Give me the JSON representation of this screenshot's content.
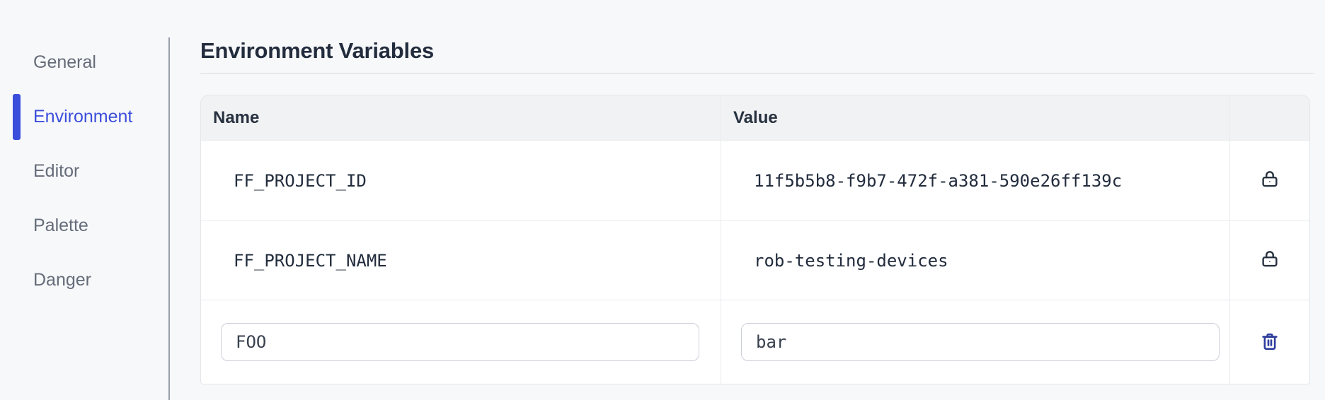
{
  "sidebar": {
    "items": [
      {
        "label": "General",
        "active": false
      },
      {
        "label": "Environment",
        "active": true
      },
      {
        "label": "Editor",
        "active": false
      },
      {
        "label": "Palette",
        "active": false
      },
      {
        "label": "Danger",
        "active": false
      }
    ]
  },
  "main": {
    "title": "Environment Variables",
    "table": {
      "headers": {
        "name": "Name",
        "value": "Value",
        "actions": ""
      },
      "rows": [
        {
          "name": "FF_PROJECT_ID",
          "value": "11f5b5b8-f9b7-472f-a381-590e26ff139c",
          "locked": true
        },
        {
          "name": "FF_PROJECT_NAME",
          "value": "rob-testing-devices",
          "locked": true
        }
      ],
      "new_row": {
        "name": "FOO",
        "value": "bar"
      }
    }
  },
  "icons": {
    "locked": "lock-icon",
    "delete": "trash-icon"
  },
  "colors": {
    "accent_blue": "#3b4edb",
    "trash_blue": "#2f3e9e",
    "text_dark": "#222c3d",
    "page_background": "#f7f8fa",
    "table_header_background": "#f1f2f4"
  }
}
